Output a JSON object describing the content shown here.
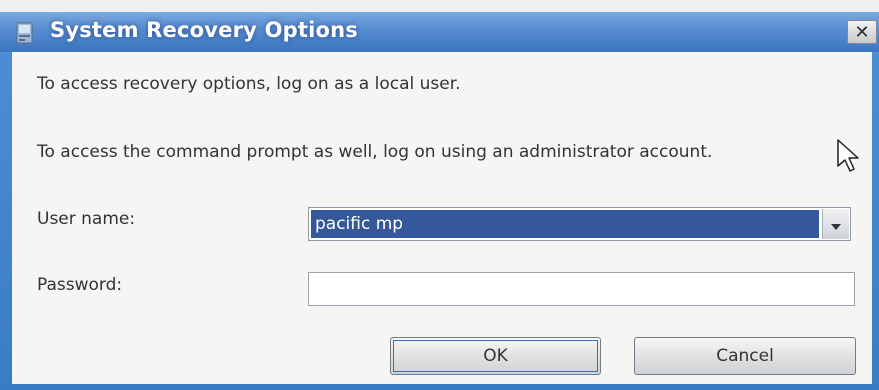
{
  "window": {
    "title": "System Recovery Options",
    "close_glyph": "✕"
  },
  "message": {
    "line1": "To access recovery options, log on as a local user.",
    "line2": "To access the command prompt as well, log on using an administrator account."
  },
  "form": {
    "username_label": "User name:",
    "username_value": "pacific mp",
    "password_label": "Password:",
    "password_value": ""
  },
  "buttons": {
    "ok_label": "OK",
    "cancel_label": "Cancel"
  },
  "icons": {
    "app": "computer-icon",
    "close": "close-icon",
    "dropdown": "chevron-down-icon",
    "cursor": "mouse-pointer-icon"
  },
  "colors": {
    "title_bar": "#4f8fd6",
    "selection": "#34589a",
    "client_bg": "#f5f5f3"
  }
}
